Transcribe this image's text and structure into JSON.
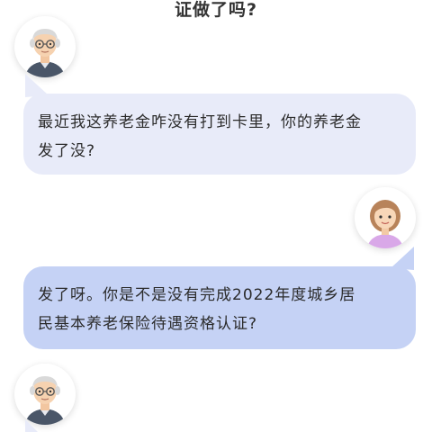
{
  "header": {
    "partial_title": "证做了吗?"
  },
  "messages": [
    {
      "sender": "elderly-man",
      "side": "left",
      "lines": [
        "最近我这养老金咋没有打到卡里，你的养老金",
        "发了没?"
      ]
    },
    {
      "sender": "woman",
      "side": "right",
      "lines": [
        "发了呀。你是不是没有完成2022年度城乡居",
        "民基本养老保险待遇资格认证?"
      ]
    }
  ],
  "colors": {
    "left_bubble": "#e8ebf9",
    "right_bubble": "#c5d2f5",
    "text": "#2b2b2b",
    "title": "#333333"
  },
  "icons": [
    "elderly-man-avatar-icon",
    "woman-avatar-icon"
  ]
}
